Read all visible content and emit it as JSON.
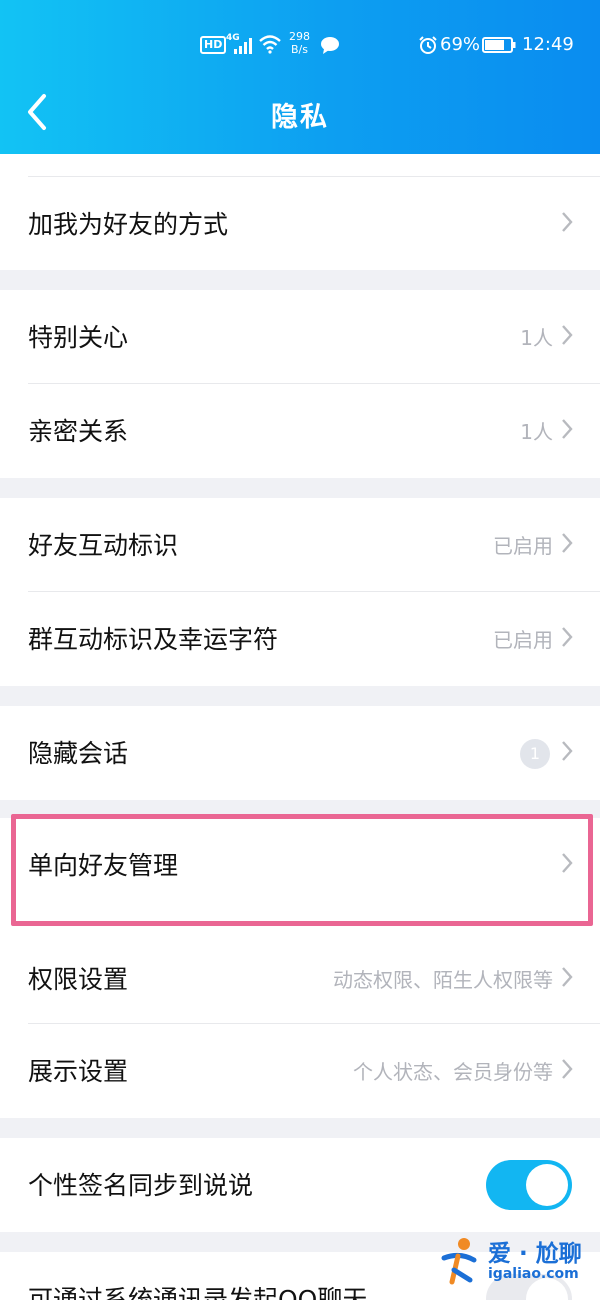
{
  "status_bar": {
    "hd": "HD",
    "network": "4G",
    "speed_value": "298",
    "speed_unit": "B/s",
    "battery_pct": "69%",
    "time": "12:49",
    "icons": [
      "signal-icon",
      "wifi-icon",
      "message-icon",
      "alarm-icon",
      "battery-icon"
    ]
  },
  "nav": {
    "title": "隐私",
    "back_icon": "chevron-left-icon"
  },
  "groups": [
    {
      "rows": [
        {
          "label": "加我为好友的方式",
          "value": ""
        }
      ]
    },
    {
      "rows": [
        {
          "label": "特别关心",
          "value": "1人"
        },
        {
          "label": "亲密关系",
          "value": "1人"
        }
      ]
    },
    {
      "rows": [
        {
          "label": "好友互动标识",
          "value": "已启用"
        },
        {
          "label": "群互动标识及幸运字符",
          "value": "已启用"
        }
      ]
    },
    {
      "rows": [
        {
          "label": "隐藏会话",
          "value": "",
          "badge": "1"
        }
      ]
    },
    {
      "rows": [
        {
          "label": "单向好友管理",
          "value": ""
        },
        {
          "label": "权限设置",
          "value": "动态权限、陌生人权限等"
        },
        {
          "label": "展示设置",
          "value": "个人状态、会员身份等"
        }
      ]
    },
    {
      "rows": [
        {
          "label": "个性签名同步到说说",
          "toggle": true
        }
      ]
    },
    {
      "rows": [
        {
          "label": "可通过系统通讯录发起QQ聊天"
        }
      ]
    }
  ],
  "highlighted_row": "单向好友管理",
  "colors": {
    "header_start": "#12c3f4",
    "header_end": "#0a8cf0",
    "highlight": "#ea6693",
    "toggle_on": "#12b6f2"
  },
  "watermark": {
    "brand": "爱 · 尬聊",
    "site": "igaliao.com"
  }
}
